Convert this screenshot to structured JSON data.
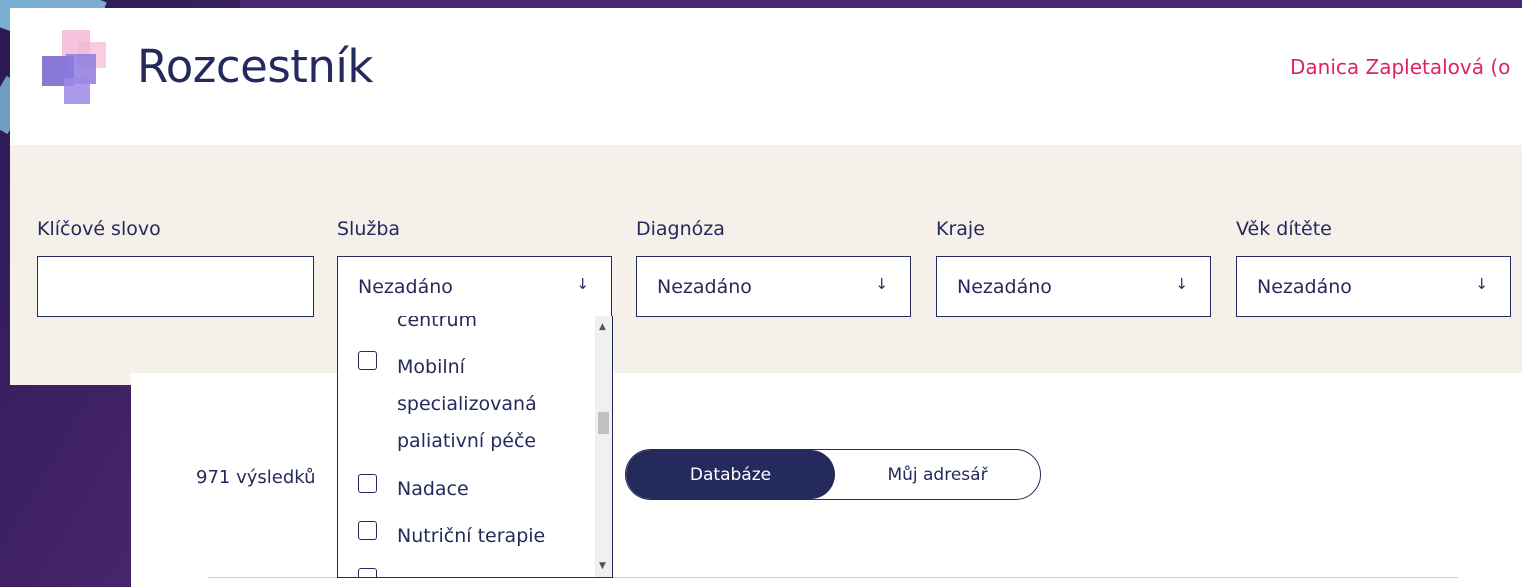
{
  "app": {
    "title": "Rozcestník",
    "user_name": "Danica Zapletalová (o"
  },
  "filters": [
    {
      "label": "Klíčové slovo",
      "value": ""
    },
    {
      "label": "Služba",
      "value": "Nezadáno"
    },
    {
      "label": "Diagnóza",
      "value": "Nezadáno"
    },
    {
      "label": "Kraje",
      "value": "Nezadáno"
    },
    {
      "label": "Věk dítěte",
      "value": "Nezadáno"
    }
  ],
  "dropdown_arrow": "↓",
  "service_options": {
    "partial_top": "centrum",
    "items": [
      {
        "lines": [
          "Mobilní",
          "specializovaná",
          "paliativní péče"
        ],
        "checked": false
      },
      {
        "lines": [
          "Nadace"
        ],
        "checked": false
      },
      {
        "lines": [
          "Nutriční terapie"
        ],
        "checked": false
      }
    ]
  },
  "results": {
    "count_text": "971 výsledků",
    "toggle": {
      "active": "Databáze",
      "inactive": "Můj adresář"
    }
  },
  "colors": {
    "primary": "#252a5c",
    "accent": "#e0245e",
    "filter_bg": "#f5f0ea"
  }
}
